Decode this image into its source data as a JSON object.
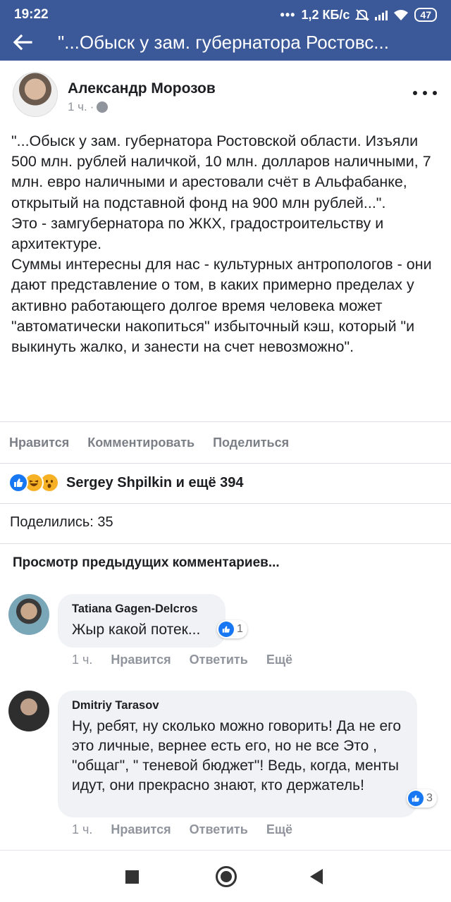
{
  "status_bar": {
    "time": "19:22",
    "network_speed": "1,2 КБ/с",
    "battery": "47"
  },
  "nav": {
    "title": "\"...Обыск у зам. губернатора Ростовс..."
  },
  "post": {
    "author": "Александр Морозов",
    "time": "1 ч.",
    "separator": "·",
    "paragraphs": [
      "\"...Обыск у зам. губернатора Ростовской области. Изъяли 500 млн. рублей наличкой, 10 млн. долларов наличными, 7 млн. евро наличными и арестовали счёт в Альфабанке, открытый на подставной фонд на 900 млн рублей...\".",
      "Это - замгубернатора по ЖКХ, градостроительству и архитектуре.",
      "Суммы интересны для нас - культурных антропологов - они дают представление о том, в каких примерно пределах у активно работающего долгое время человека может \"автоматически накопиться\" избыточный кэш, который \"и выкинуть жалко, и занести на счет невозможно\"."
    ],
    "actions": {
      "like": "Нравится",
      "comment": "Комментировать",
      "share": "Поделиться"
    },
    "reactions_text": "Sergey Shpilkin и ещё 394",
    "shares_text": "Поделились: 35",
    "previous_comments": "Просмотр предыдущих комментариев..."
  },
  "comments": [
    {
      "author": "Tatiana Gagen-Delcros",
      "text": "Жыр какой потек...",
      "reaction_count": "1",
      "time": "1 ч.",
      "like": "Нравится",
      "reply": "Ответить",
      "more": "Ещё"
    },
    {
      "author": "Dmitriy Tarasov",
      "text": "Ну, ребят, ну сколько можно говорить! Да не его это личные, вернее есть его, но не все Это , \"общаг\", \" теневой бюджет\"! Ведь, когда, менты идут, они прекрасно знают, кто держатель!",
      "reaction_count": "3",
      "time": "1 ч.",
      "like": "Нравится",
      "reply": "Ответить",
      "more": "Ещё"
    }
  ],
  "colors": {
    "header_bg": "#3b5998",
    "like_blue": "#1877f2",
    "muted": "#90949c"
  }
}
